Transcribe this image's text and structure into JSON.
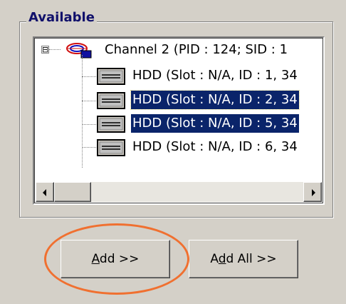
{
  "group": {
    "title": "Available"
  },
  "tree": {
    "expander": "⊟",
    "channel": {
      "label": "Channel 2 (PID : 124; SID : 1"
    },
    "items": [
      {
        "label": "HDD  (Slot : N/A, ID : 1, 34",
        "selected": false
      },
      {
        "label": "HDD  (Slot : N/A, ID : 2, 34",
        "selected": true
      },
      {
        "label": "HDD  (Slot : N/A, ID : 5, 34",
        "selected": true
      },
      {
        "label": "HDD  (Slot : N/A, ID : 6, 34",
        "selected": false
      }
    ]
  },
  "buttons": {
    "add": {
      "pre": "",
      "accel": "A",
      "post": "dd >>"
    },
    "add_all": {
      "pre": "A",
      "accel": "d",
      "post": "d All >>"
    }
  },
  "colors": {
    "selection": "#0a246a",
    "highlight_ring": "#f07030",
    "title": "#10106b"
  }
}
